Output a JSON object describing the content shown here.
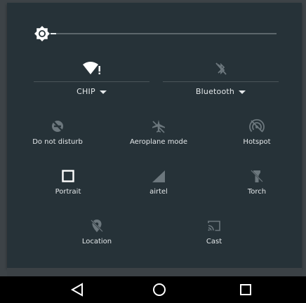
{
  "brightness": {
    "level": 0.03
  },
  "wifi_tile": {
    "label": "CHIP"
  },
  "bluetooth_tile": {
    "label": "Bluetooth"
  },
  "tiles": {
    "dnd": {
      "label": "Do not disturb"
    },
    "aeroplane": {
      "label": "Aeroplane mode"
    },
    "hotspot": {
      "label": "Hotspot"
    },
    "portrait": {
      "label": "Portrait"
    },
    "airtel": {
      "label": "airtel"
    },
    "torch": {
      "label": "Torch"
    },
    "location": {
      "label": "Location"
    },
    "cast": {
      "label": "Cast"
    }
  },
  "nav": {
    "back": "back-icon",
    "home": "home-icon",
    "recents": "recents-icon"
  },
  "colors": {
    "panel": "#263238",
    "active_icon": "#ffffff",
    "inactive_icon": "#6c777d",
    "text": "#e4e8ea"
  }
}
